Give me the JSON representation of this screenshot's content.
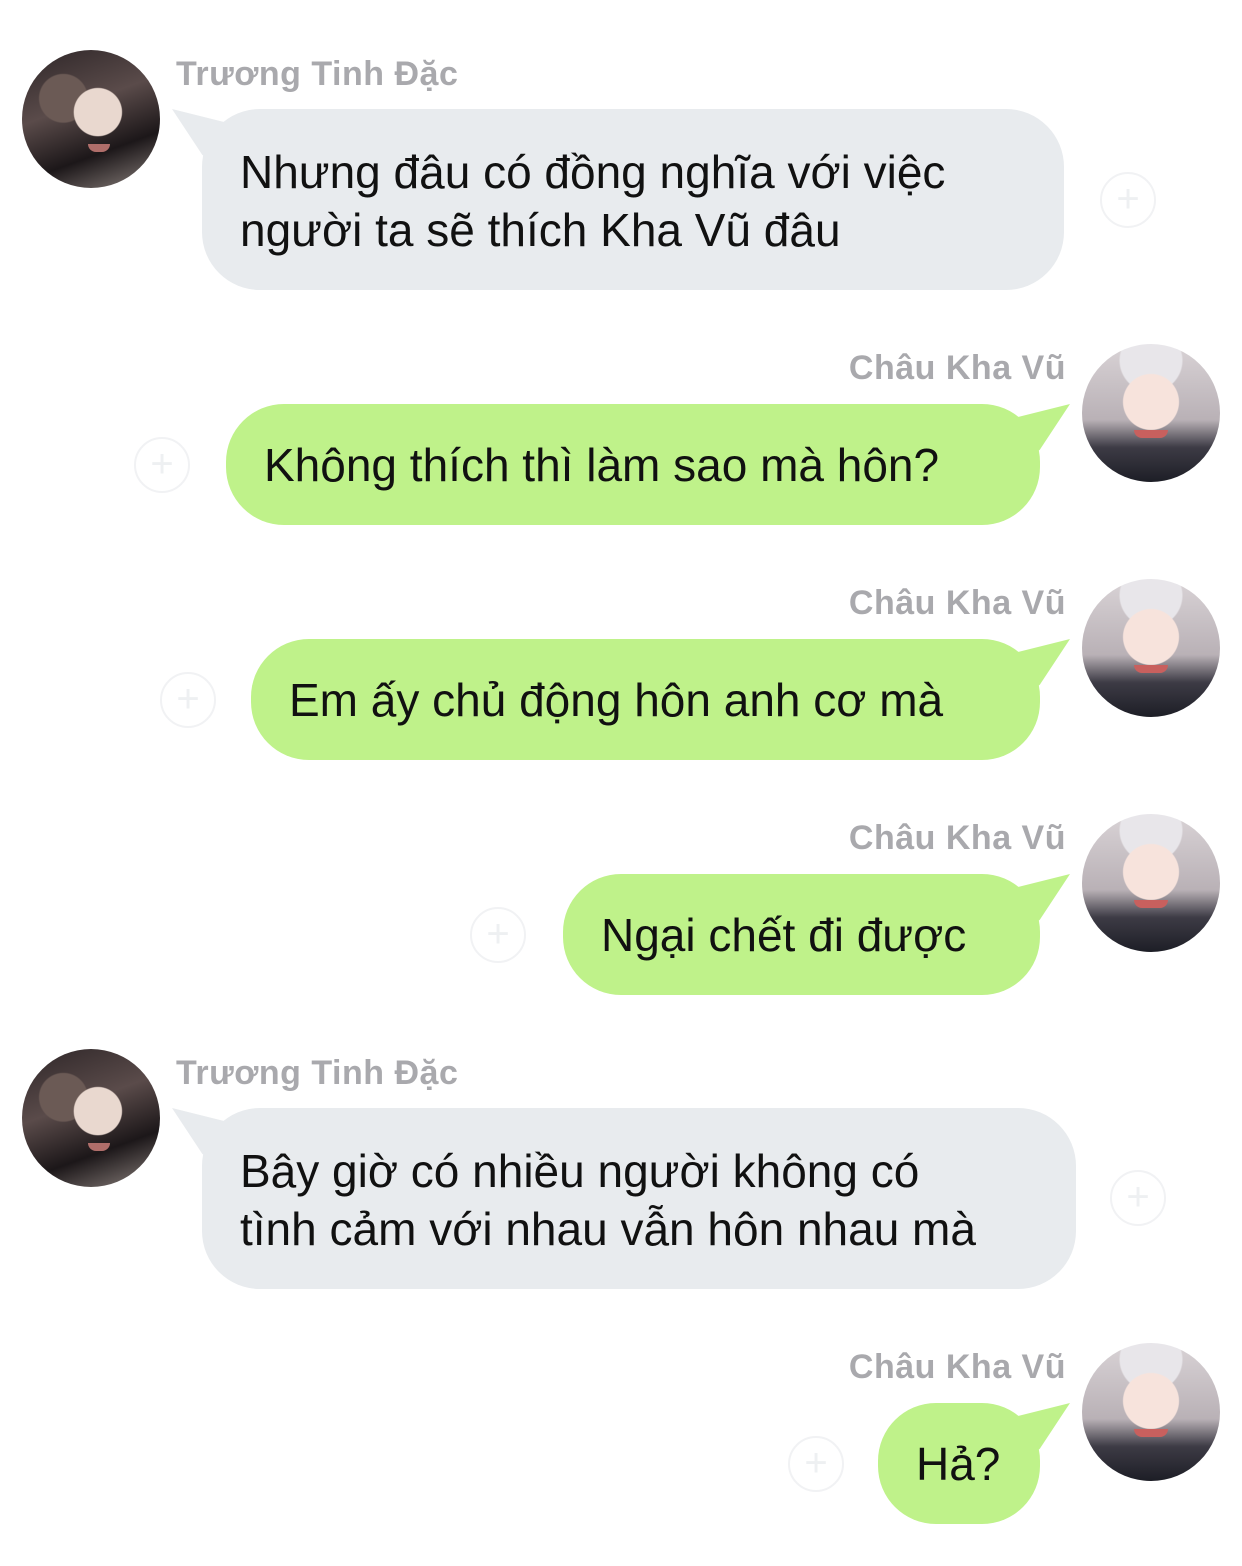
{
  "messages": [
    {
      "sender": "Trương Tinh Đặc",
      "side": "left",
      "lines": [
        "Nhưng đâu có đồng nghĩa với việc",
        "người ta sẽ thích Kha Vũ đâu"
      ]
    },
    {
      "sender": "Châu Kha Vũ",
      "side": "right",
      "lines": [
        "Không thích thì làm sao mà hôn?"
      ]
    },
    {
      "sender": "Châu Kha Vũ",
      "side": "right",
      "lines": [
        "Em ấy chủ động hôn anh cơ mà"
      ]
    },
    {
      "sender": "Châu Kha Vũ",
      "side": "right",
      "lines": [
        "Ngại chết đi được"
      ]
    },
    {
      "sender": "Trương Tinh Đặc",
      "side": "left",
      "lines": [
        "Bây giờ có nhiều người không có",
        "tình cảm với nhau vẫn hôn nhau mà"
      ]
    },
    {
      "sender": "Châu Kha Vũ",
      "side": "right",
      "lines": [
        "Hả?"
      ]
    }
  ],
  "icons": {
    "add": "+"
  },
  "colors": {
    "incoming_bubble": "#e8ebee",
    "outgoing_bubble": "#bff28a",
    "sender_name": "#a9a9ad"
  }
}
